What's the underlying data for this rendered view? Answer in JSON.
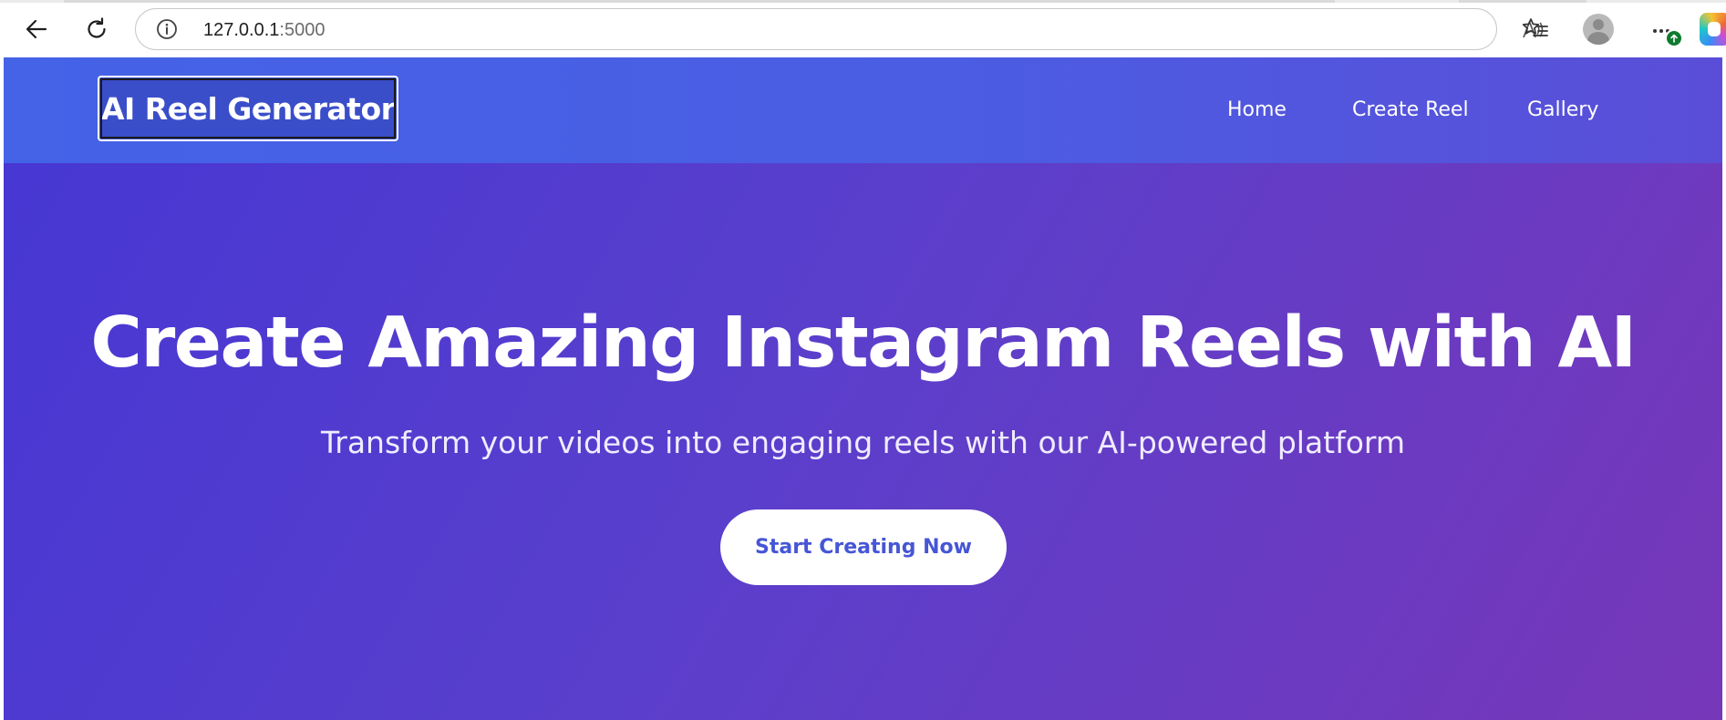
{
  "browser": {
    "url_host": "127.0.0.1",
    "url_port": ":5000",
    "icons": {
      "back": "arrow-left-icon",
      "reload": "reload-icon",
      "site_info": "info-icon",
      "read_aloud": "read-aloud-icon",
      "favorite": "star-icon",
      "favorites_list": "favorites-icon",
      "profile": "avatar-icon",
      "menu": "more-icon",
      "update": "update-arrow-icon",
      "copilot": "copilot-icon"
    }
  },
  "site": {
    "logo": "AI Reel Generator",
    "nav": [
      "Home",
      "Create Reel",
      "Gallery"
    ]
  },
  "hero": {
    "title": "Create Amazing Instagram Reels with AI",
    "subtitle": "Transform your videos into engaging reels with our AI-powered platform",
    "cta_label": "Start Creating Now"
  },
  "colors": {
    "header_start": "#4463e7",
    "header_end": "#5a4ed8",
    "hero_start": "#4737d3",
    "hero_end": "#7737b9",
    "cta_text": "#4656d6",
    "update_badge": "#0e7a2e"
  }
}
